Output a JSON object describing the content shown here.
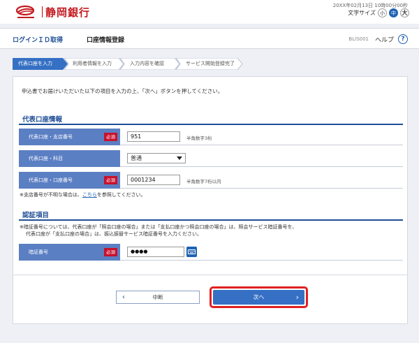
{
  "brand": {
    "name": "静岡銀行"
  },
  "topbar": {
    "datetime": "20XX年02月13日 10時00分00秒",
    "font_size_label": "文字サイズ",
    "font_sizes": [
      "小",
      "中",
      "大"
    ]
  },
  "header": {
    "title": "ログインＩＤ取得",
    "subtitle": "口座情報登録",
    "screen_code": "BLIS001",
    "help_label": "ヘルプ",
    "help_icon": "question-circle-icon"
  },
  "steps": [
    {
      "label": "代表口座を入力",
      "active": true
    },
    {
      "label": "利用者情報を入力",
      "active": false
    },
    {
      "label": "入力内容を確認",
      "active": false
    },
    {
      "label": "サービス開始登録完了",
      "active": false
    }
  ],
  "intro": "申込書でお届けいただいた以下の項目を入力の上、「次へ」ボタンを押してください。",
  "account_section": {
    "title": "代表口座情報",
    "required_label": "必須",
    "branch": {
      "label": "代表口座・支店番号",
      "value": "951",
      "hint": "半角数字3桁"
    },
    "type": {
      "label": "代表口座・科目",
      "value": "普通"
    },
    "number": {
      "label": "代表口座・口座番号",
      "value": "0001234",
      "hint": "半角数字7桁以内"
    },
    "note_prefix": "※支店番号が不明な場合は、",
    "note_link": "こちら",
    "note_suffix": "を参照してください。"
  },
  "auth_section": {
    "title": "認証項目",
    "note_line1": "※暗証番号については、代表口座が「照会口座の場合」または「支払口座かつ照会口座の場合」は、照会サービス暗証番号を、",
    "note_line2": "代表口座が「支払口座の場合」は、振込振替サービス暗証番号を入力ください。",
    "pin": {
      "label": "暗証番号",
      "value": "●●●●",
      "keyboard_icon": "keyboard-icon"
    }
  },
  "buttons": {
    "cancel_label": "中断",
    "next_label": "次へ"
  },
  "colors": {
    "brand_red": "#c41a20",
    "primary_blue": "#1f4f96",
    "label_blue": "#5b7fc3",
    "required_red": "#c8102e",
    "highlight_red": "#e02020"
  }
}
